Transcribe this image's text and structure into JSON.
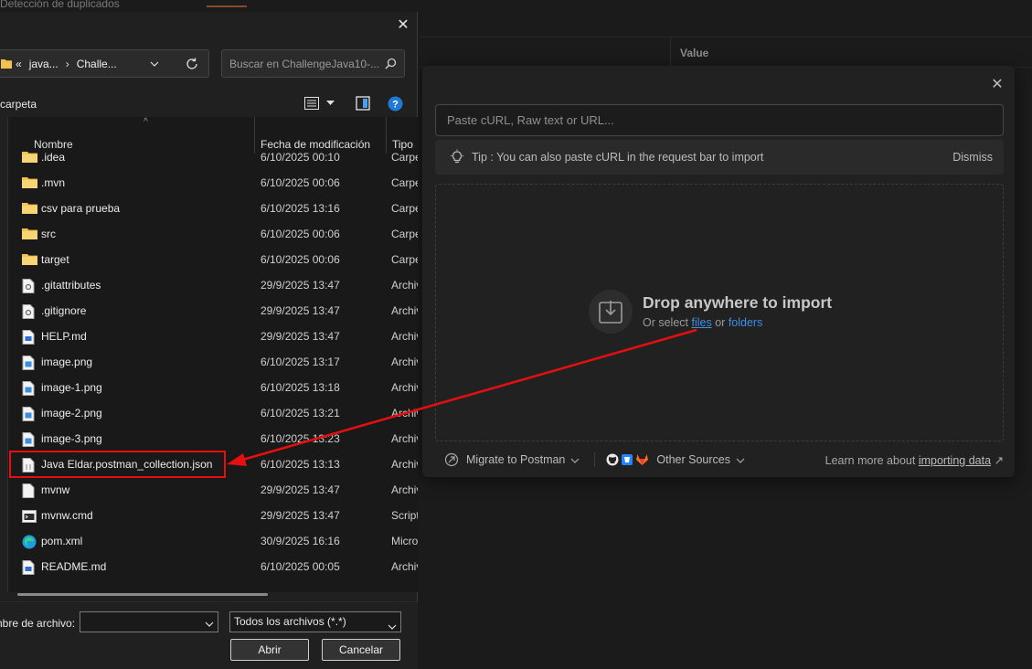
{
  "background": {
    "top_title": "Detección de duplicados",
    "column_value": "Value"
  },
  "import_modal": {
    "close_symbol": "✕",
    "paste_placeholder": "Paste cURL, Raw text or URL...",
    "tip_text": "Tip : You can also paste cURL in the request bar to import",
    "dismiss_label": "Dismiss",
    "drop_title": "Drop anywhere to import",
    "drop_sub_prefix": "Or select",
    "drop_files_link": "files",
    "drop_or": "or",
    "drop_folders_link": "folders",
    "migrate_label": "Migrate to Postman",
    "other_sources_label": "Other Sources",
    "learn_prefix": "Learn more about",
    "learn_link": "importing data",
    "learn_arrow": "↗"
  },
  "file_dialog": {
    "close_symbol": "✕",
    "address": {
      "prefix": "«",
      "segments": [
        "java...",
        "Challe..."
      ]
    },
    "search_placeholder": "Buscar en ChallengeJava10-...",
    "new_folder_label": "carpeta",
    "columns": {
      "name": "Nombre",
      "date": "Fecha de modificación",
      "type": "Tipo"
    },
    "files": [
      {
        "name": ".idea",
        "date": "6/10/2025 00:10",
        "type": "Carpeta",
        "icon": "folder-icon"
      },
      {
        "name": ".mvn",
        "date": "6/10/2025 00:06",
        "type": "Carpeta",
        "icon": "folder-icon"
      },
      {
        "name": "csv para prueba",
        "date": "6/10/2025 13:16",
        "type": "Carpeta",
        "icon": "folder-icon"
      },
      {
        "name": "src",
        "date": "6/10/2025 00:06",
        "type": "Carpeta",
        "icon": "folder-icon"
      },
      {
        "name": "target",
        "date": "6/10/2025 00:06",
        "type": "Carpeta",
        "icon": "folder-icon"
      },
      {
        "name": ".gitattributes",
        "date": "29/9/2025 13:47",
        "type": "Archivo",
        "icon": "config-file-icon"
      },
      {
        "name": ".gitignore",
        "date": "29/9/2025 13:47",
        "type": "Archivo",
        "icon": "config-file-icon"
      },
      {
        "name": "HELP.md",
        "date": "29/9/2025 13:47",
        "type": "Archivo",
        "icon": "markdown-file-icon"
      },
      {
        "name": "image.png",
        "date": "6/10/2025 13:17",
        "type": "Archivo",
        "icon": "image-file-icon"
      },
      {
        "name": "image-1.png",
        "date": "6/10/2025 13:18",
        "type": "Archivo",
        "icon": "image-file-icon"
      },
      {
        "name": "image-2.png",
        "date": "6/10/2025 13:21",
        "type": "Archivo",
        "icon": "image-file-icon"
      },
      {
        "name": "image-3.png",
        "date": "6/10/2025 13:23",
        "type": "Archivo",
        "icon": "image-file-icon"
      },
      {
        "name": "Java Eldar.postman_collection.json",
        "date": "6/10/2025 13:13",
        "type": "Archivo",
        "icon": "json-file-icon"
      },
      {
        "name": "mvnw",
        "date": "29/9/2025 13:47",
        "type": "Archivo",
        "icon": "file-icon"
      },
      {
        "name": "mvnw.cmd",
        "date": "29/9/2025 13:47",
        "type": "Script",
        "icon": "cmd-file-icon"
      },
      {
        "name": "pom.xml",
        "date": "30/9/2025 16:16",
        "type": "Microsoft",
        "icon": "edge-icon"
      },
      {
        "name": "README.md",
        "date": "6/10/2025 00:05",
        "type": "Archivo",
        "icon": "markdown-file-icon"
      }
    ],
    "filename_label": "nbre de archivo:",
    "filename_value": "",
    "filetype_value": "Todos los archivos (*.*)",
    "open_button": "Abrir",
    "cancel_button": "Cancelar"
  },
  "colors": {
    "annotation_red": "#e60f0f",
    "link_blue": "#3d8fe8",
    "folder_yellow": "#f2c14e"
  }
}
